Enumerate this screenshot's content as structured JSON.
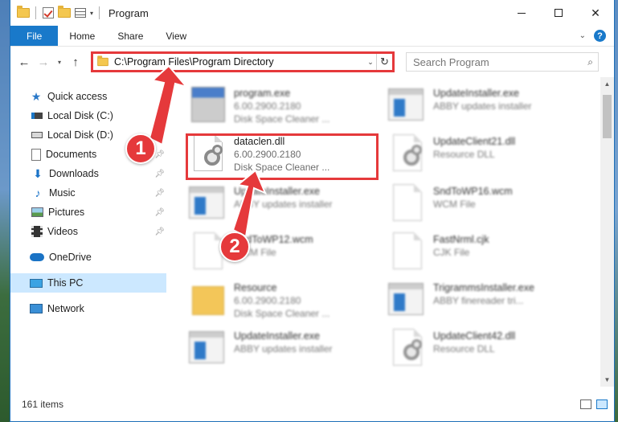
{
  "window": {
    "title": "Program",
    "controls": {
      "minimize": "minimize",
      "maximize": "maximize",
      "close": "✕"
    }
  },
  "ribbon": {
    "tabs": [
      "File",
      "Home",
      "Share",
      "View"
    ],
    "help_icon": "?"
  },
  "nav": {
    "address": "C:\\Program Files\\Program Directory",
    "search_placeholder": "Search Program"
  },
  "sidebar": {
    "items": [
      {
        "label": "Quick access",
        "icon": "star-icon"
      },
      {
        "label": "Local Disk (C:)",
        "icon": "drive-icon",
        "pinned": true
      },
      {
        "label": "Local Disk (D:)",
        "icon": "drive-icon",
        "pinned": true
      },
      {
        "label": "Documents",
        "icon": "documents-icon",
        "pinned": true
      },
      {
        "label": "Downloads",
        "icon": "download-icon",
        "pinned": true
      },
      {
        "label": "Music",
        "icon": "music-icon",
        "pinned": true
      },
      {
        "label": "Pictures",
        "icon": "pictures-icon",
        "pinned": true
      },
      {
        "label": "Videos",
        "icon": "videos-icon",
        "pinned": true
      },
      {
        "label": "OneDrive",
        "icon": "cloud-icon"
      },
      {
        "label": "This PC",
        "icon": "pc-icon",
        "selected": true
      },
      {
        "label": "Network",
        "icon": "network-icon"
      }
    ]
  },
  "files": [
    {
      "name": "program.exe",
      "line2": "6.00.2900.2180",
      "line3": "Disk Space Cleaner ...",
      "icon": "exe"
    },
    {
      "name": "UpdateInstaller.exe",
      "line2": "ABBY updates installer",
      "line3": "",
      "icon": "win"
    },
    {
      "name": "dataclen.dll",
      "line2": "6.00.2900.2180",
      "line3": "Disk Space Cleaner ...",
      "icon": "gear"
    },
    {
      "name": "UpdateClient21.dll",
      "line2": "Resource DLL",
      "line3": "",
      "icon": "gear"
    },
    {
      "name": "UpdateInstaller.exe",
      "line2": "ABBY updates installer",
      "line3": "",
      "icon": "win"
    },
    {
      "name": "SndToWP16.wcm",
      "line2": "WCM File",
      "line3": "",
      "icon": "doc"
    },
    {
      "name": "SndToWP12.wcm",
      "line2": "WCM File",
      "line3": "",
      "icon": "doc"
    },
    {
      "name": "FastNrml.cjk",
      "line2": "CJK File",
      "line3": "",
      "icon": "doc"
    },
    {
      "name": "Resource",
      "line2": "6.00.2900.2180",
      "line3": "Disk Space Cleaner ...",
      "icon": "folder"
    },
    {
      "name": "TrigrammsInstaller.exe",
      "line2": "ABBY finereader tri...",
      "line3": "",
      "icon": "win"
    },
    {
      "name": "UpdateInstaller.exe",
      "line2": "ABBY updates installer",
      "line3": "",
      "icon": "win"
    },
    {
      "name": "UpdateClient42.dll",
      "line2": "Resource DLL",
      "line3": "",
      "icon": "gear"
    }
  ],
  "status": {
    "item_count": "161 items"
  },
  "annotations": {
    "step1": "1",
    "step2": "2"
  },
  "colors": {
    "accent": "#1979ca",
    "highlight": "#e5393b",
    "selected": "#cce8ff"
  }
}
